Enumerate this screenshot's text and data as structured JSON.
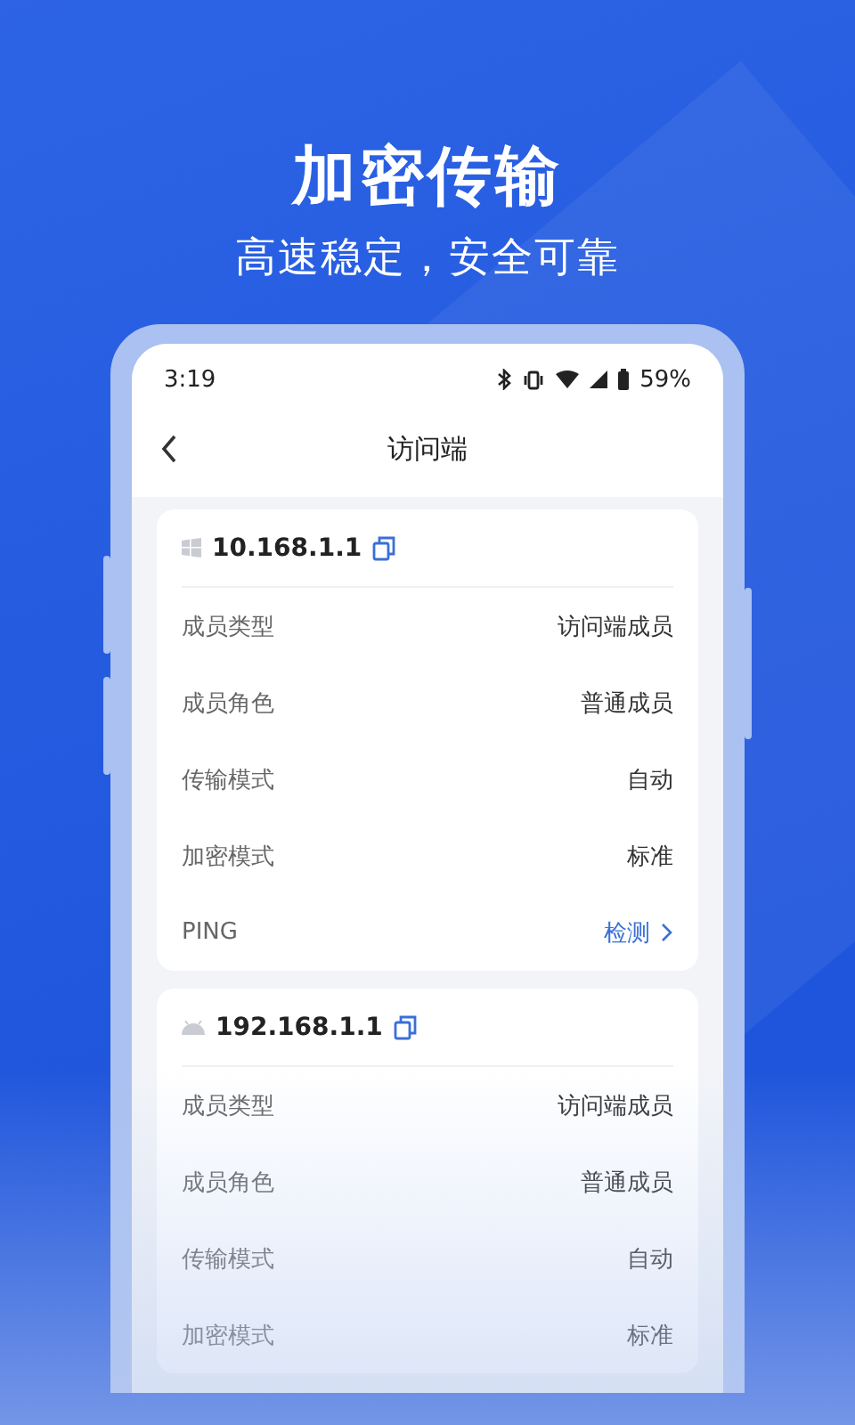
{
  "headline": "加密传输",
  "subheadline": "高速稳定，安全可靠",
  "status_bar": {
    "time": "3:19",
    "battery": "59%"
  },
  "nav": {
    "title": "访问端"
  },
  "devices": [
    {
      "ip": "10.168.1.1",
      "kind": "windows",
      "rows": [
        {
          "kind": "detail",
          "label": "成员类型",
          "value": "访问端成员"
        },
        {
          "kind": "detail",
          "label": "成员角色",
          "value": "普通成员"
        },
        {
          "kind": "detail",
          "label": "传输模式",
          "value": "自动"
        },
        {
          "kind": "detail",
          "label": "加密模式",
          "value": "标准"
        },
        {
          "kind": "action",
          "label": "PING",
          "value": "检测"
        }
      ]
    },
    {
      "ip": "192.168.1.1",
      "kind": "android",
      "rows": [
        {
          "kind": "detail",
          "label": "成员类型",
          "value": "访问端成员"
        },
        {
          "kind": "detail",
          "label": "成员角色",
          "value": "普通成员"
        },
        {
          "kind": "detail",
          "label": "传输模式",
          "value": "自动"
        },
        {
          "kind": "detail",
          "label": "加密模式",
          "value": "标准"
        }
      ]
    }
  ]
}
